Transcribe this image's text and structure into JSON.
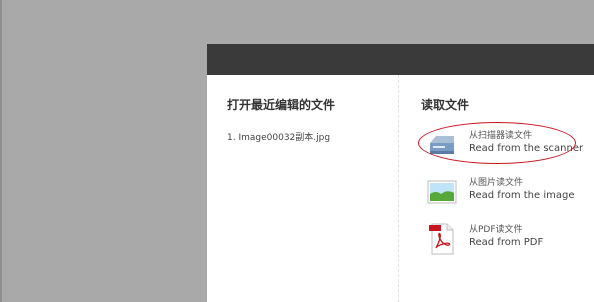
{
  "recent": {
    "heading": "打开最近编辑的文件",
    "items": [
      "1. Image00032副本.jpg"
    ]
  },
  "read": {
    "heading": "读取文件",
    "options": [
      {
        "zh": "从扫描器读文件",
        "en": "Read from the scanner",
        "icon": "scanner-icon"
      },
      {
        "zh": "从图片读文件",
        "en": "Read from the image",
        "icon": "image-icon"
      },
      {
        "zh": "从PDF读文件",
        "en": "Read from PDF",
        "icon": "pdf-icon"
      }
    ]
  },
  "colors": {
    "titlebar": "#3a3a3a",
    "backdrop": "#a9a9a9",
    "highlight_circle": "#c8141e"
  }
}
